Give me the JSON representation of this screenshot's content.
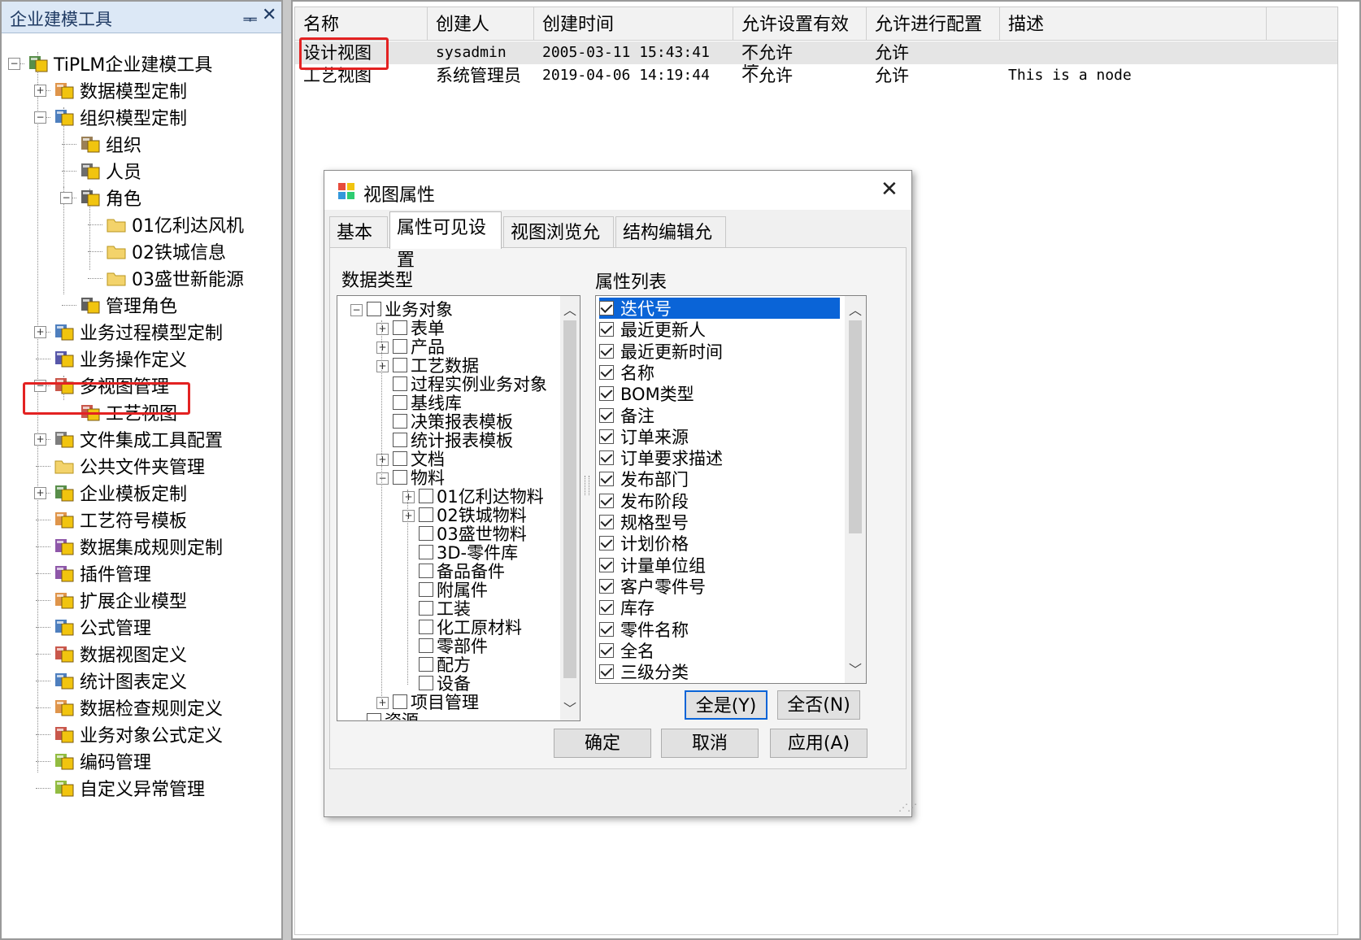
{
  "left_panel": {
    "title": "企业建模工具",
    "pin_glyph": "ᆍ",
    "close_glyph": "✕",
    "tree": [
      {
        "id": "root",
        "label": "TiPLM企业建模工具",
        "toggle": "−",
        "icon": "root-app-icon",
        "icon_color": "#3b7a2a"
      },
      {
        "id": "data-model",
        "label": "数据模型定制",
        "toggle": "+",
        "icon": "data-model-icon",
        "icon_color": "#d9822b"
      },
      {
        "id": "org-model",
        "label": "组织模型定制",
        "toggle": "−",
        "icon": "org-model-icon",
        "icon_color": "#2f68b3"
      },
      {
        "id": "org",
        "label": "组织",
        "icon": "org-icon",
        "icon_color": "#8a6a3a"
      },
      {
        "id": "person",
        "label": "人员",
        "icon": "person-icon",
        "icon_color": "#555555"
      },
      {
        "id": "role",
        "label": "角色",
        "toggle": "−",
        "icon": "role-icon",
        "icon_color": "#444444"
      },
      {
        "id": "role-1",
        "label": "01亿利达风机",
        "icon": "folder-icon",
        "icon_color": "#f3d36b"
      },
      {
        "id": "role-2",
        "label": "02铁城信息",
        "icon": "folder-icon",
        "icon_color": "#f3d36b"
      },
      {
        "id": "role-3",
        "label": "03盛世新能源",
        "icon": "folder-icon",
        "icon_color": "#f3d36b"
      },
      {
        "id": "admin-role",
        "label": "管理角色",
        "icon": "admin-role-icon",
        "icon_color": "#444444"
      },
      {
        "id": "biz-process",
        "label": "业务过程模型定制",
        "toggle": "+",
        "icon": "process-icon",
        "icon_color": "#2f68b3"
      },
      {
        "id": "biz-op",
        "label": "业务操作定义",
        "icon": "operation-icon",
        "icon_color": "#3a3a9a"
      },
      {
        "id": "multi-view",
        "label": "多视图管理",
        "toggle": "−",
        "icon": "multi-view-icon",
        "icon_color": "#c0392b"
      },
      {
        "id": "craft-view",
        "label": "工艺视图",
        "icon": "view-icon",
        "icon_color": "#c0392b"
      },
      {
        "id": "file-tool",
        "label": "文件集成工具配置",
        "toggle": "+",
        "icon": "file-tool-icon",
        "icon_color": "#666666"
      },
      {
        "id": "public-folder",
        "label": "公共文件夹管理",
        "icon": "folder-icon",
        "icon_color": "#f3d36b"
      },
      {
        "id": "enterprise-template",
        "label": "企业模板定制",
        "toggle": "+",
        "icon": "template-icon",
        "icon_color": "#3b7a2a"
      },
      {
        "id": "craft-symbol",
        "label": "工艺符号模板",
        "icon": "symbol-icon",
        "icon_color": "#d9822b"
      },
      {
        "id": "data-integration",
        "label": "数据集成规则定制",
        "icon": "integration-icon",
        "icon_color": "#7a3a9a"
      },
      {
        "id": "plugin",
        "label": "插件管理",
        "icon": "plugin-icon",
        "icon_color": "#7a3a9a"
      },
      {
        "id": "ext-model",
        "label": "扩展企业模型",
        "icon": "extension-icon",
        "icon_color": "#d9822b"
      },
      {
        "id": "formula",
        "label": "公式管理",
        "icon": "formula-icon",
        "icon_color": "#2f68b3"
      },
      {
        "id": "data-view-def",
        "label": "数据视图定义",
        "icon": "data-view-icon",
        "icon_color": "#c0392b"
      },
      {
        "id": "stat-chart",
        "label": "统计图表定义",
        "icon": "stat-chart-icon",
        "icon_color": "#2f68b3"
      },
      {
        "id": "data-check",
        "label": "数据检查规则定义",
        "icon": "check-rule-icon",
        "icon_color": "#d9822b"
      },
      {
        "id": "biz-formula",
        "label": "业务对象公式定义",
        "icon": "biz-formula-icon",
        "icon_color": "#c0392b"
      },
      {
        "id": "encoding",
        "label": "编码管理",
        "icon": "encoding-icon",
        "icon_color": "#7fb020"
      },
      {
        "id": "custom-exception",
        "label": "自定义异常管理",
        "icon": "exception-icon",
        "icon_color": "#7fb020"
      }
    ]
  },
  "grid": {
    "columns": [
      "名称",
      "创建人",
      "创建时间",
      "允许设置有效性",
      "允许进行配置",
      "描述"
    ],
    "rows": [
      {
        "name": "设计视图",
        "creator": "sysadmin",
        "created": "2005-03-11 15:43:41",
        "validity": "不允许",
        "config": "允许",
        "desc": ""
      },
      {
        "name": "工艺视图",
        "creator": "系统管理员",
        "created": "2019-04-06 14:19:44",
        "validity": "不允许",
        "config": "允许",
        "desc": "This is a node"
      }
    ]
  },
  "dialog": {
    "title": "视图属性",
    "close_glyph": "✕",
    "tabs": [
      "基本",
      "属性可见设置",
      "视图浏览允许",
      "结构编辑允许"
    ],
    "active_tab": "属性可见设置",
    "data_type_label": "数据类型",
    "attr_list_label": "属性列表",
    "data_types": [
      {
        "label": "业务对象",
        "toggle": "−"
      },
      {
        "label": "表单",
        "toggle": "+"
      },
      {
        "label": "产品",
        "toggle": "+"
      },
      {
        "label": "工艺数据",
        "toggle": "+"
      },
      {
        "label": "过程实例业务对象"
      },
      {
        "label": "基线库"
      },
      {
        "label": "决策报表模板"
      },
      {
        "label": "统计报表模板"
      },
      {
        "label": "文档",
        "toggle": "+"
      },
      {
        "label": "物料",
        "toggle": "−"
      },
      {
        "label": "01亿利达物料",
        "toggle": "+"
      },
      {
        "label": "02铁城物料",
        "toggle": "+"
      },
      {
        "label": "03盛世物料"
      },
      {
        "label": "3D-零件库"
      },
      {
        "label": "备品备件"
      },
      {
        "label": "附属件"
      },
      {
        "label": "工装"
      },
      {
        "label": "化工原材料"
      },
      {
        "label": "零部件"
      },
      {
        "label": "配方"
      },
      {
        "label": "设备"
      },
      {
        "label": "项目管理",
        "toggle": "+"
      },
      {
        "label": "资源"
      }
    ],
    "attributes": [
      {
        "label": "迭代号",
        "checked": true,
        "selected": true
      },
      {
        "label": "最近更新人",
        "checked": true
      },
      {
        "label": "最近更新时间",
        "checked": true
      },
      {
        "label": "名称",
        "checked": true
      },
      {
        "label": "BOM类型",
        "checked": true
      },
      {
        "label": "备注",
        "checked": true
      },
      {
        "label": "订单来源",
        "checked": true
      },
      {
        "label": "订单要求描述",
        "checked": true
      },
      {
        "label": "发布部门",
        "checked": true
      },
      {
        "label": "发布阶段",
        "checked": true
      },
      {
        "label": "规格型号",
        "checked": true
      },
      {
        "label": "计划价格",
        "checked": true
      },
      {
        "label": "计量单位组",
        "checked": true
      },
      {
        "label": "客户零件号",
        "checked": true
      },
      {
        "label": "库存",
        "checked": true
      },
      {
        "label": "零件名称",
        "checked": true
      },
      {
        "label": "全名",
        "checked": true
      },
      {
        "label": "三级分类",
        "checked": true
      }
    ],
    "select_all_label": "全是(Y)",
    "select_none_label": "全否(N)",
    "ok_label": "确定",
    "cancel_label": "取消",
    "apply_label": "应用(A)"
  },
  "colors": {
    "highlight_border": "#e32222",
    "selection": "#0a64d7",
    "panel_header": "#dce8f6"
  }
}
